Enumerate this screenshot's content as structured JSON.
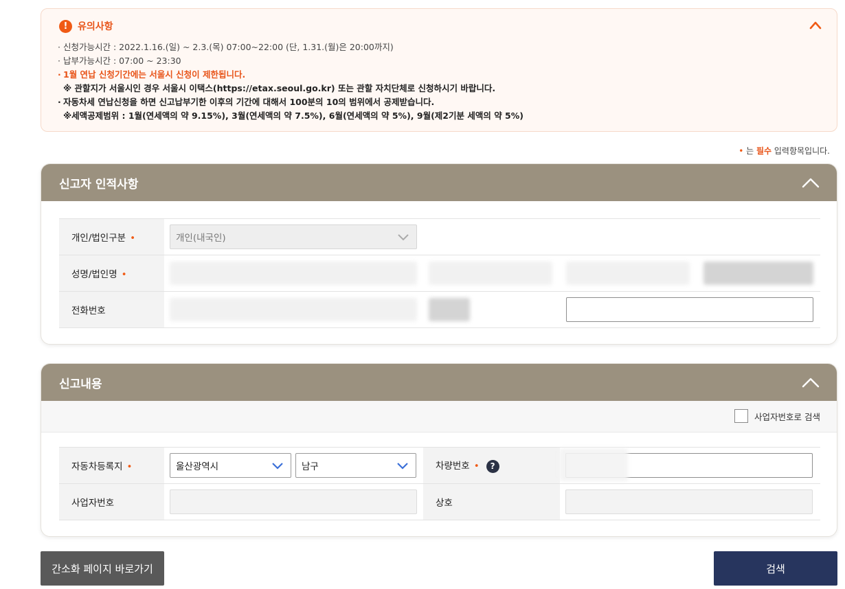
{
  "notice": {
    "title": "유의사항",
    "items": [
      "신청가능시간 : 2022.1.16.(일) ~ 2.3.(목) 07:00~22:00 (단, 1.31.(월)은 20:00까지)",
      "납부가능시간 : 07:00 ~ 23:30"
    ],
    "warning": "1월 연납 신청기간에는 서울시 신청이 제한됩니다.",
    "warning_sub": "※ 관할지가 서울시인 경우 서울시 이택스(https://etax.seoul.go.kr) 또는 관할 자치단체로 신청하시기 바랍니다.",
    "deduction": "자동차세 연납신청을 하면 신고납부기한 이후의 기간에 대해서 100분의 10의 범위에서 공제받습니다.",
    "deduction_sub": "※세액공제범위 : 1월(연세액의 약 9.15%), 3월(연세액의 약 7.5%), 6월(연세액의 약 5%), 9월(제2기분 세액의 약 5%)"
  },
  "required_note": {
    "dot": "•",
    "prefix": " 는 ",
    "emph": "필수",
    "suffix": " 입력항목입니다."
  },
  "applicant": {
    "title": "신고자 인적사항",
    "type_label": "개인/법인구분",
    "type_value": "개인(내국인)",
    "name_label": "성명/법인명",
    "phone_label": "전화번호"
  },
  "report": {
    "title": "신고내용",
    "biz_search_label": "사업자번호로 검색",
    "region_label": "자동차등록지",
    "region_city": "울산광역시",
    "region_district": "남구",
    "car_no_label": "차량번호",
    "biz_no_label": "사업자번호",
    "company_label": "상호"
  },
  "buttons": {
    "simple_page": "간소화 페이지 바로가기",
    "search": "검색"
  },
  "colors": {
    "accent": "#e8551a",
    "panel_header": "#9b917f",
    "primary_button": "#27355e",
    "secondary_button": "#595959"
  }
}
